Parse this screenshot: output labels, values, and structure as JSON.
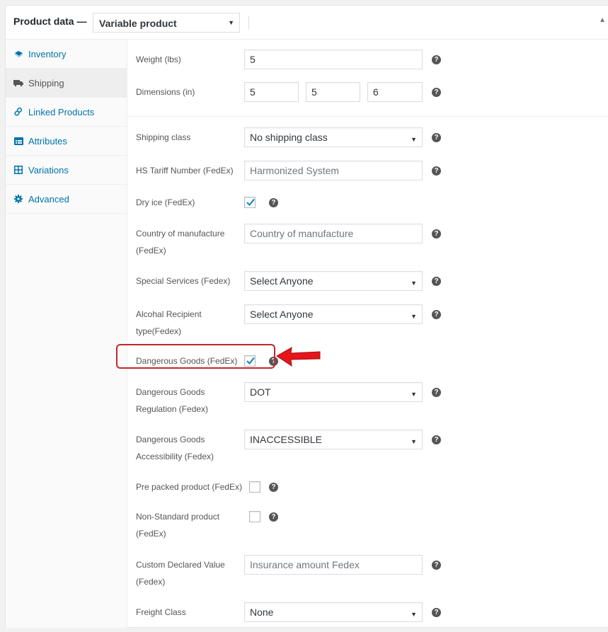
{
  "header": {
    "title": "Product data —",
    "product_type": "Variable product",
    "collapse_icon": "triangle-up-icon"
  },
  "sidebar": {
    "items": [
      {
        "label": "Inventory",
        "icon": "tag-icon",
        "active": false
      },
      {
        "label": "Shipping",
        "icon": "truck-icon",
        "active": true
      },
      {
        "label": "Linked Products",
        "icon": "link-icon",
        "active": false
      },
      {
        "label": "Attributes",
        "icon": "list-card-icon",
        "active": false
      },
      {
        "label": "Variations",
        "icon": "grid-icon",
        "active": false
      },
      {
        "label": "Advanced",
        "icon": "gear-icon",
        "active": false
      }
    ]
  },
  "fields": {
    "weight": {
      "label": "Weight (lbs)",
      "value": "5"
    },
    "dimensions": {
      "label": "Dimensions (in)",
      "length": "5",
      "width": "5",
      "height": "6"
    },
    "shipping_class": {
      "label": "Shipping class",
      "value": "No shipping class"
    },
    "hs_tariff": {
      "label": "HS Tariff Number (FedEx)",
      "placeholder": "Harmonized System"
    },
    "dry_ice": {
      "label": "Dry ice (FedEx)",
      "checked": true
    },
    "country": {
      "label_line1": "Country of manufacture",
      "label_line2": "(FedEx)",
      "placeholder": "Country of manufacture"
    },
    "special_services": {
      "label": "Special Services (Fedex)",
      "value": "Select Anyone"
    },
    "alcohol": {
      "label_line1": "Alcohal Recipient",
      "label_line2": "type(Fedex)",
      "value": "Select Anyone"
    },
    "dangerous_goods": {
      "label": "Dangerous Goods (FedEx)",
      "checked": true
    },
    "dg_regulation": {
      "label_line1": "Dangerous Goods",
      "label_line2": "Regulation (Fedex)",
      "value": "DOT"
    },
    "dg_accessibility": {
      "label_line1": "Dangerous Goods",
      "label_line2": "Accessibility (Fedex)",
      "value": "INACCESSIBLE"
    },
    "pre_packed": {
      "label": "Pre packed product (FedEx)",
      "checked": false
    },
    "non_standard": {
      "label_line1": "Non-Standard product",
      "label_line2": "(FedEx)",
      "checked": false
    },
    "declared_value": {
      "label_line1": "Custom Declared Value",
      "label_line2": "(Fedex)",
      "placeholder": "Insurance amount Fedex"
    },
    "freight_class": {
      "label": "Freight Class",
      "value": "None"
    }
  },
  "help_glyph": "?",
  "select_caret": "▼",
  "annotation": {
    "highlight_color": "#c1272d",
    "arrow_color": "#e8141b"
  },
  "colors": {
    "link": "#0073aa",
    "active_tab_bg": "#eeeeee",
    "checkmark": "#1e8cbe"
  }
}
